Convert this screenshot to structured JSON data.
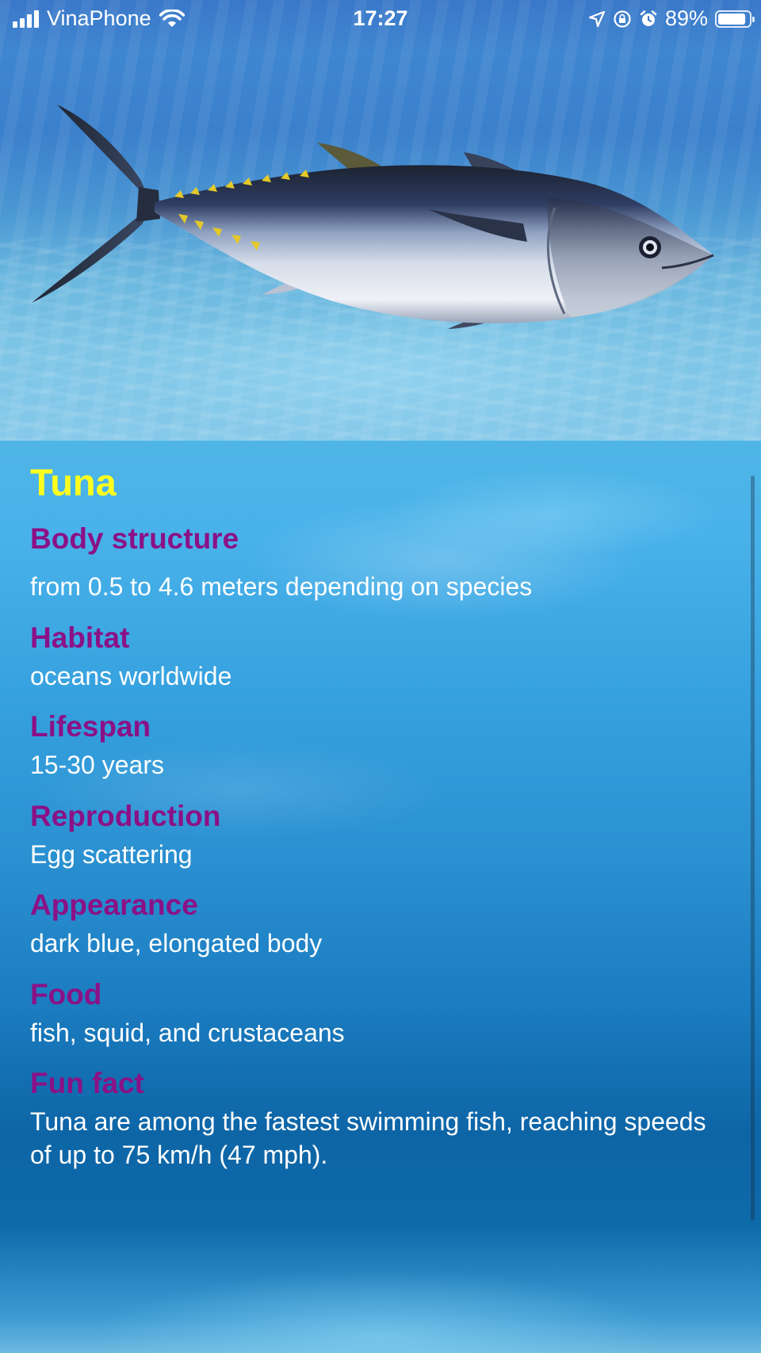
{
  "status_bar": {
    "carrier": "VinaPhone",
    "time": "17:27",
    "battery_percent": "89%",
    "battery_level": 0.89,
    "icons": [
      "signal-icon",
      "wifi-icon",
      "location-arrow-icon",
      "rotation-lock-icon",
      "alarm-icon",
      "battery-icon"
    ]
  },
  "hero": {
    "image": "tuna-photo"
  },
  "fish": {
    "name": "Tuna",
    "sections": [
      {
        "title": "Body structure",
        "text": "from 0.5 to 4.6 meters depending on species"
      },
      {
        "title": "Habitat",
        "text": "oceans worldwide"
      },
      {
        "title": "Lifespan",
        "text": "15-30 years"
      },
      {
        "title": "Reproduction",
        "text": "Egg scattering"
      },
      {
        "title": "Appearance",
        "text": "dark blue, elongated body"
      },
      {
        "title": "Food",
        "text": "fish, squid, and crustaceans"
      },
      {
        "title": "Fun fact",
        "text": "Tuna are among the fastest swimming fish, reaching speeds of up to 75 km/h (47 mph)."
      }
    ]
  },
  "colors": {
    "name": "#ffff1e",
    "section_title": "#8b1186",
    "section_text": "#ffffff",
    "hero_water": "#3f86d0",
    "panel_water": "#2b91d2"
  }
}
